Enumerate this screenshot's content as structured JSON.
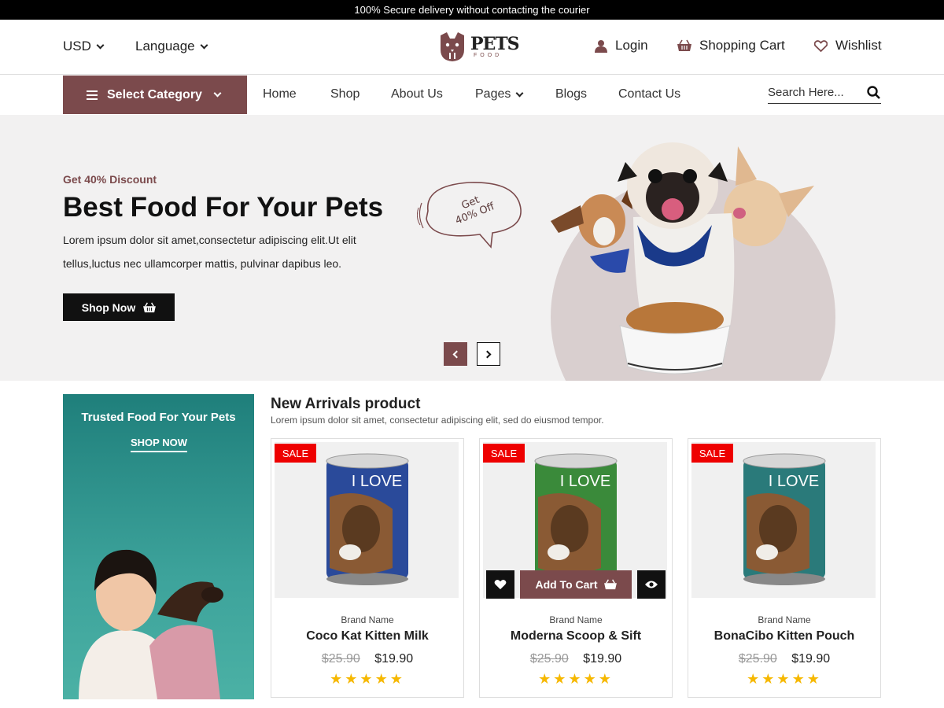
{
  "topbar": {
    "text": "100% Secure delivery without contacting the courier"
  },
  "header": {
    "currency": "USD",
    "language": "Language",
    "logo": {
      "main": "PETS",
      "sub": "FOOD"
    },
    "login": "Login",
    "cart": "Shopping Cart",
    "wishlist": "Wishlist"
  },
  "nav": {
    "category": "Select Category",
    "items": [
      "Home",
      "Shop",
      "About Us",
      "Pages",
      "Blogs",
      "Contact Us"
    ],
    "search_placeholder": "Search Here..."
  },
  "hero": {
    "kicker": "Get 40% Discount",
    "title": "Best Food For Your Pets",
    "description": "Lorem ipsum dolor sit amet,consectetur adipiscing elit.Ut elit tellus,luctus nec ullamcorper mattis, pulvinar dapibus leo.",
    "button": "Shop Now",
    "bubble_line1": "Get",
    "bubble_line2": "40% Off"
  },
  "promo": {
    "title": "Trusted Food For Your Pets",
    "link": "SHOP NOW"
  },
  "arrivals": {
    "title": "New Arrivals product",
    "subtitle": "Lorem ipsum dolor sit amet, consectetur adipiscing elit, sed do eiusmod tempor.",
    "add_to_cart": "Add To Cart",
    "products": [
      {
        "badge": "SALE",
        "brand": "Brand Name",
        "name": "Coco Kat Kitten Milk",
        "old_price": "$25.90",
        "price": "$19.90",
        "stars": "★★★★★",
        "can_label": "I LOVE",
        "can_color": "#2a4a9a"
      },
      {
        "badge": "SALE",
        "brand": "Brand Name",
        "name": "Moderna Scoop & Sift",
        "old_price": "$25.90",
        "price": "$19.90",
        "stars": "★★★★★",
        "can_label": "I LOVE",
        "can_color": "#3a8a3a"
      },
      {
        "badge": "SALE",
        "brand": "Brand Name",
        "name": "BonaCibo Kitten Pouch",
        "old_price": "$25.90",
        "price": "$19.90",
        "stars": "★★★★★",
        "can_label": "I LOVE",
        "can_color": "#2a7a7a"
      }
    ]
  },
  "colors": {
    "brand": "#7b4a4c",
    "sale": "#ee0000",
    "star": "#f6b800",
    "promo": "#2f958f"
  }
}
